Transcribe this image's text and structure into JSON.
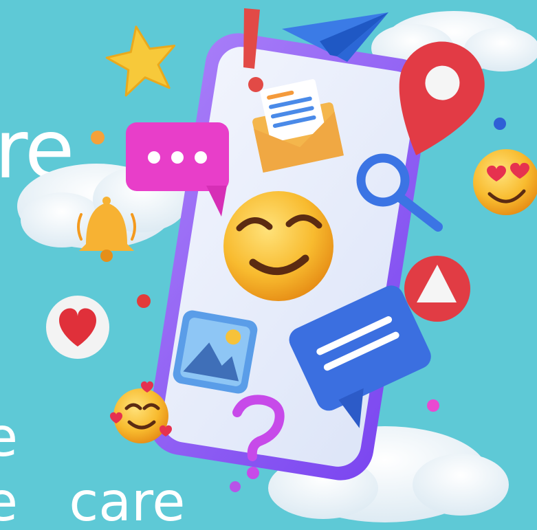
{
  "background_color": "#5ec9d6",
  "text_fragments": {
    "word_top": "re",
    "word_mid": "e",
    "word_bottom": "e   care"
  },
  "icons": {
    "star": "star-icon",
    "exclamation": "exclamation-icon",
    "paper_plane": "paper-plane-icon",
    "location_pin": "location-pin-icon",
    "chat_bubble": "chat-bubble-icon",
    "envelope": "envelope-icon",
    "search": "magnifier-icon",
    "heart_eyes": "heart-eyes-emoji-icon",
    "bell": "bell-icon",
    "smile": "smiling-emoji-icon",
    "play": "play-icon",
    "heart": "heart-icon",
    "image": "image-icon",
    "message": "message-icon",
    "in_love": "in-love-emoji-icon",
    "question": "question-mark-icon"
  },
  "colors": {
    "phone_frame": "#8b5cf6",
    "phone_screen": "#e8eefb",
    "pink_bubble": "#e83ec9",
    "blue_bubble": "#3b6fe0",
    "red_pin": "#e23b45",
    "emoji_yellow": "#f6b62e"
  }
}
